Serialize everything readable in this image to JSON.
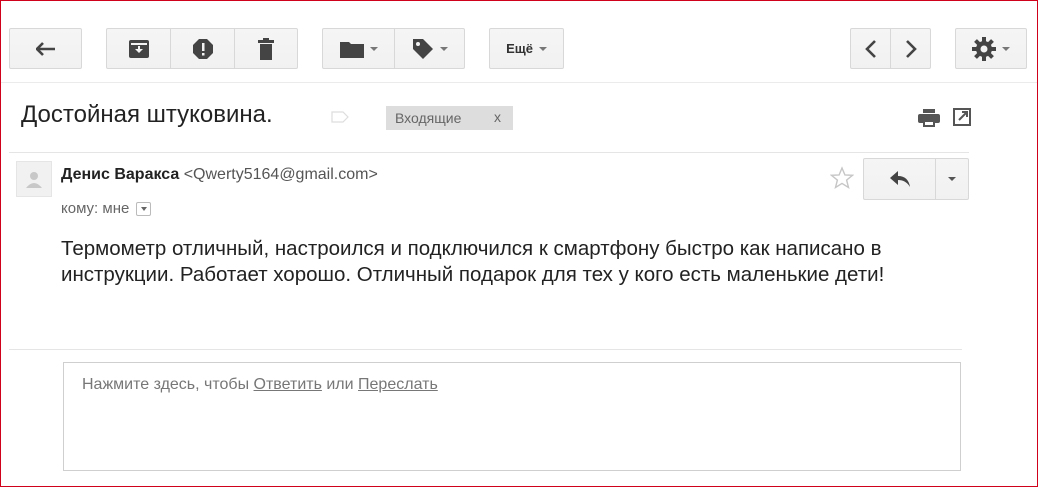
{
  "toolbar": {
    "back_icon": "arrow-back-icon",
    "archive_icon": "archive-icon",
    "spam_icon": "report-spam-icon",
    "delete_icon": "trash-icon",
    "move_icon": "folder-icon",
    "labels_icon": "label-tag-icon",
    "more_label": "Ещё",
    "older_icon": "chevron-left-icon",
    "newer_icon": "chevron-right-icon",
    "settings_icon": "gear-icon"
  },
  "thread": {
    "subject": "Достойная штуковина.",
    "label": "Входящие",
    "label_remove": "x"
  },
  "message": {
    "sender_name": "Денис Варакса",
    "sender_email": "<Qwerty5164@gmail.com>",
    "recipient": "кому: мне",
    "body": "Термометр отличный, настроился и подключился к смартфону быстро как написано в инструкции. Работает хорошо. Отличный подарок для тех у кого есть маленькие дети!"
  },
  "reply": {
    "prefix": "Нажмите здесь, чтобы ",
    "reply_link": "Ответить",
    "middle": " или ",
    "forward_link": "Переслать"
  },
  "colors": {
    "frame_border": "#d0021b",
    "button_bg": "#f5f5f5",
    "label_bg": "#dddddd"
  }
}
